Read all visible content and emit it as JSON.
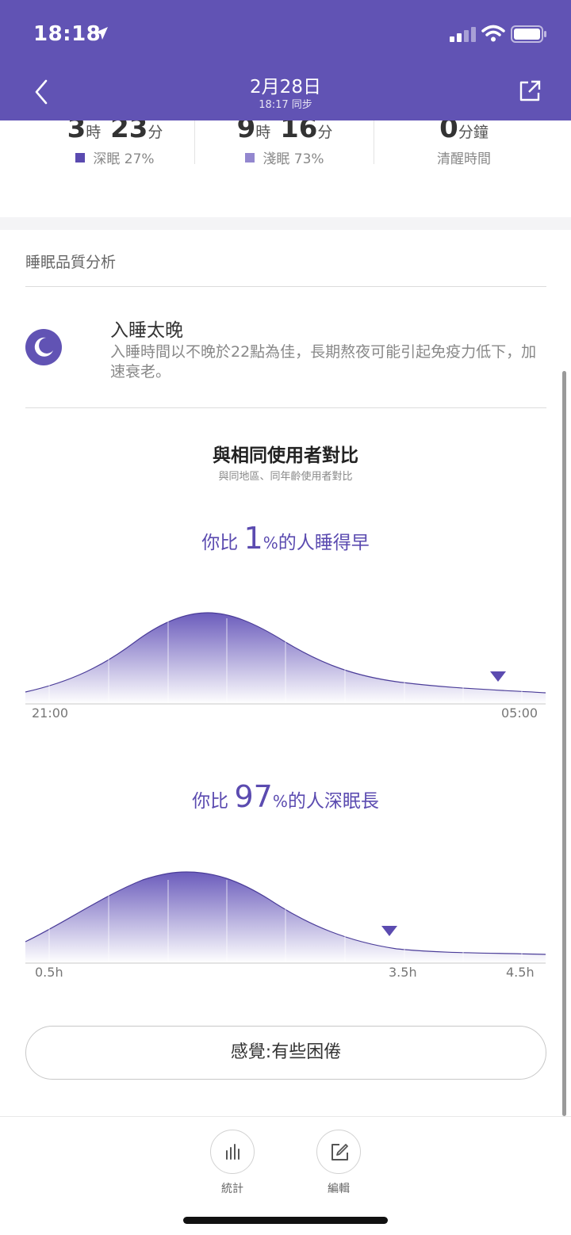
{
  "status_bar": {
    "time": "18:18"
  },
  "header": {
    "date": "2月28日",
    "sync_text": "18:17 同步"
  },
  "summary": {
    "deep": {
      "h": "3",
      "h_unit": "時",
      "m": "23",
      "m_unit": "分",
      "label": "深眠 27%",
      "color": "#5a4ab0"
    },
    "light": {
      "h": "9",
      "h_unit": "時",
      "m": "16",
      "m_unit": "分",
      "label": "淺眠 73%",
      "color": "#9387cf"
    },
    "awake": {
      "m": "0",
      "m_unit": "分鐘",
      "label": "清醒時間"
    }
  },
  "analysis": {
    "section_title": "睡眠品質分析",
    "tip_title": "入睡太晚",
    "tip_body": "入睡時間以不晚於22點為佳，長期熬夜可能引起免疫力低下，加速衰老。"
  },
  "comparison": {
    "title": "與相同使用者對比",
    "subtitle": "與同地區、同年齡使用者對比",
    "chart1": {
      "prefix": "你比",
      "pct": "1",
      "pct_sign": "%",
      "suffix": "的人睡得早",
      "x_start": "21:00",
      "x_end": "05:00"
    },
    "chart2": {
      "prefix": "你比",
      "pct": "97",
      "pct_sign": "%",
      "suffix": "的人深眠長",
      "labels": [
        "0.5h",
        "3.5h",
        "4.5h"
      ]
    }
  },
  "feel_button": "感覺:有些困倦",
  "bottom_nav": {
    "stats": "統計",
    "edit": "編輯"
  },
  "colors": {
    "header": "#6153b4",
    "accent": "#5b4bb0"
  }
}
